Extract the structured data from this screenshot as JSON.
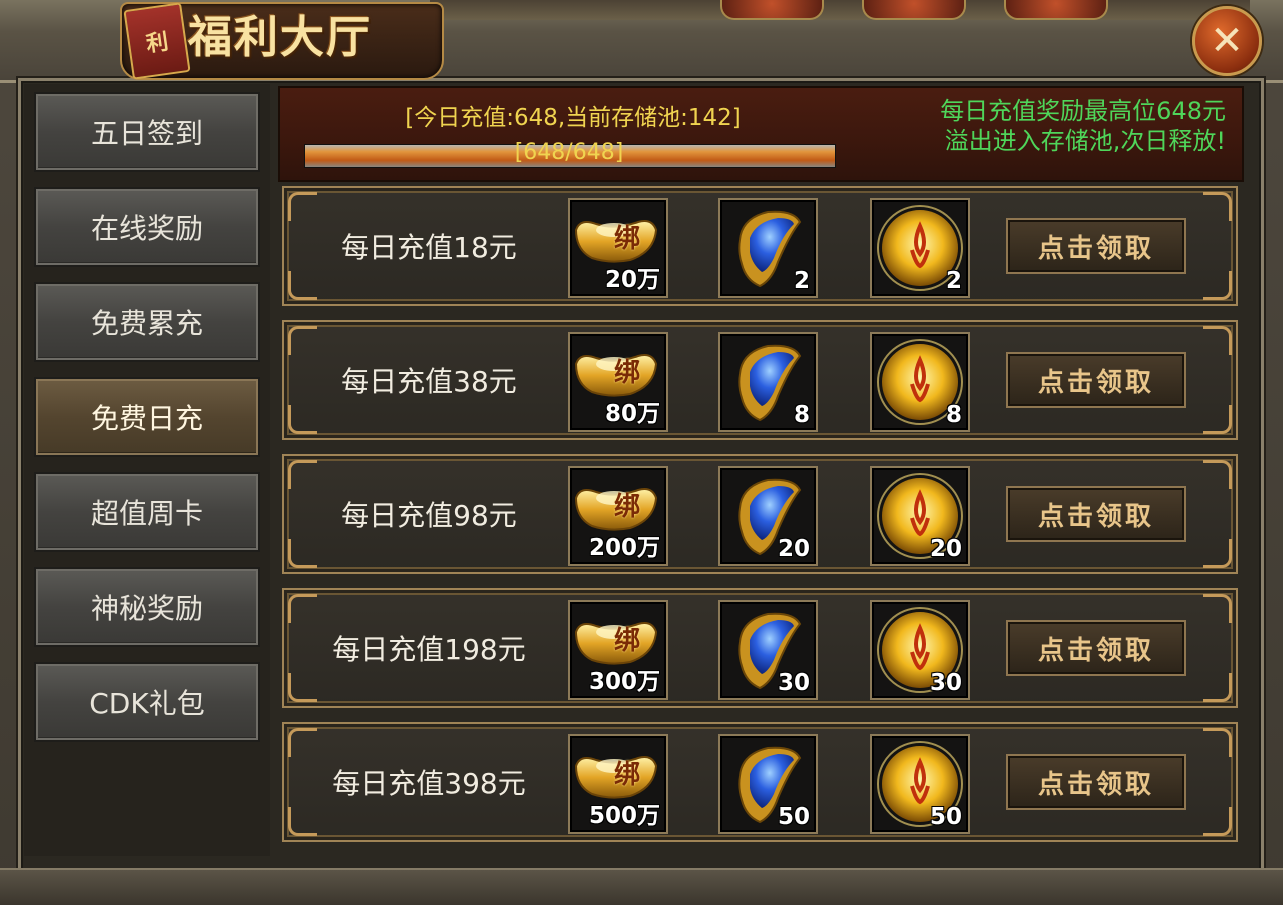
{
  "title": {
    "tag": "利",
    "text": "福利大厅"
  },
  "close_label": "✕",
  "sidebar": {
    "items": [
      {
        "label": "五日签到"
      },
      {
        "label": "在线奖励"
      },
      {
        "label": "免费累充"
      },
      {
        "label": "免费日充",
        "active": true
      },
      {
        "label": "超值周卡"
      },
      {
        "label": "神秘奖励"
      },
      {
        "label": "CDK礼包"
      }
    ]
  },
  "header": {
    "status": "[今日充值:648,当前存储池:142]",
    "progress_label": "[648/648]",
    "progress_value": 648,
    "progress_max": 648,
    "notice_line1": "每日充值奖励最高位648元",
    "notice_line2": "溢出进入存储池,次日释放!"
  },
  "rows": [
    {
      "label": "每日充值18元",
      "gold": "20万",
      "gem": "2",
      "orb": "2",
      "button": "点击领取"
    },
    {
      "label": "每日充值38元",
      "gold": "80万",
      "gem": "8",
      "orb": "8",
      "button": "点击领取"
    },
    {
      "label": "每日充值98元",
      "gold": "200万",
      "gem": "20",
      "orb": "20",
      "button": "点击领取"
    },
    {
      "label": "每日充值198元",
      "gold": "300万",
      "gem": "30",
      "orb": "30",
      "button": "点击领取"
    },
    {
      "label": "每日充值398元",
      "gold": "500万",
      "gem": "50",
      "orb": "50",
      "button": "点击领取"
    }
  ],
  "icons": {
    "gold": "gold-ingot-bound-icon",
    "gem": "blue-gem-icon",
    "orb": "golden-orb-icon"
  },
  "ingot_badge": "绑",
  "colors": {
    "header_text": "#f0d450",
    "notice_text": "#4fd65a",
    "accent_gold": "#e8c58a"
  }
}
